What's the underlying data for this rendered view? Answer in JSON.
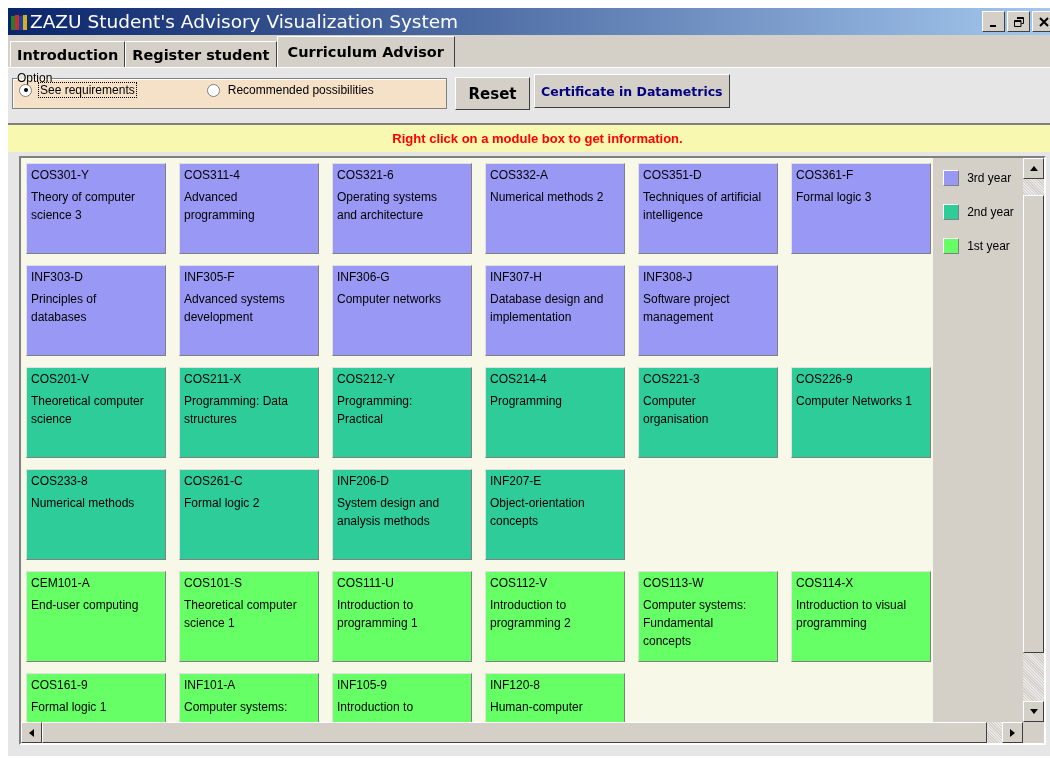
{
  "window": {
    "title": "ZAZU Student's Advisory Visualization System"
  },
  "tabs": [
    {
      "label": "Introduction",
      "selected": false
    },
    {
      "label": "Register student",
      "selected": false
    },
    {
      "label": "Curriculum  Advisor",
      "selected": true
    }
  ],
  "option": {
    "legend": "Option",
    "radios": [
      {
        "label": "See requirements",
        "selected": true
      },
      {
        "label": "Recommended possibilities",
        "selected": false
      }
    ]
  },
  "buttons": [
    {
      "label": "Reset",
      "kind": "plain"
    },
    {
      "label": "Certificate in Datametrics",
      "kind": "accent"
    }
  ],
  "hint": "Right click on a module box to get information.",
  "module_rows": [
    {
      "modules": [
        {
          "code": "COS301-Y",
          "title": "Theory of computer science 3",
          "color": "#9999f5"
        },
        {
          "code": "COS311-4",
          "title": "Advanced programming",
          "color": "#9999f5"
        },
        {
          "code": "COS321-6",
          "title": "Operating systems and architecture",
          "color": "#9999f5"
        },
        {
          "code": "COS332-A",
          "title": "Numerical methods 2",
          "color": "#9999f5"
        },
        {
          "code": "COS351-D",
          "title": "Techniques of artificial intelligence",
          "color": "#9999f5"
        },
        {
          "code": "COS361-F",
          "title": "Formal logic 3",
          "color": "#9999f5"
        }
      ]
    },
    {
      "modules": [
        {
          "code": "INF303-D",
          "title": "Principles of databases",
          "color": "#9999f5"
        },
        {
          "code": "INF305-F",
          "title": "Advanced systems development",
          "color": "#9999f5"
        },
        {
          "code": "INF306-G",
          "title": "Computer networks",
          "color": "#9999f5"
        },
        {
          "code": "INF307-H",
          "title": "Database design and implementation",
          "color": "#9999f5"
        },
        {
          "code": "INF308-J",
          "title": "Software project management",
          "color": "#9999f5"
        }
      ]
    },
    {
      "modules": [
        {
          "code": "COS201-V",
          "title": "Theoretical computer science",
          "color": "#2ecc99"
        },
        {
          "code": "COS211-X",
          "title": "Programming: Data structures",
          "color": "#2ecc99"
        },
        {
          "code": "COS212-Y",
          "title": "Programming: Practical",
          "color": "#2ecc99"
        },
        {
          "code": "COS214-4",
          "title": "Programming",
          "color": "#2ecc99"
        },
        {
          "code": "COS221-3",
          "title": "Computer organisation",
          "color": "#2ecc99"
        },
        {
          "code": "COS226-9",
          "title": "Computer Networks 1",
          "color": "#2ecc99"
        }
      ]
    },
    {
      "modules": [
        {
          "code": "COS233-8",
          "title": "Numerical methods",
          "color": "#2ecc99"
        },
        {
          "code": "COS261-C",
          "title": "Formal logic 2",
          "color": "#2ecc99"
        },
        {
          "code": "INF206-D",
          "title": "System design and analysis methods",
          "color": "#2ecc99"
        },
        {
          "code": "INF207-E",
          "title": "Object-orientation concepts",
          "color": "#2ecc99"
        }
      ]
    },
    {
      "modules": [
        {
          "code": "CEM101-A",
          "title": "End-user computing",
          "color": "#66ff66"
        },
        {
          "code": "COS101-S",
          "title": "Theoretical computer science 1",
          "color": "#66ff66"
        },
        {
          "code": "COS111-U",
          "title": "Introduction to programming 1",
          "color": "#66ff66"
        },
        {
          "code": "COS112-V",
          "title": "Introduction to programming 2",
          "color": "#66ff66"
        },
        {
          "code": "COS113-W",
          "title": "Computer systems: Fundamental concepts",
          "color": "#66ff66"
        },
        {
          "code": "COS114-X",
          "title": "Introduction to visual programming",
          "color": "#66ff66"
        }
      ]
    },
    {
      "modules": [
        {
          "code": "COS161-9",
          "title": "Formal logic 1",
          "color": "#66ff66"
        },
        {
          "code": "INF101-A",
          "title": "Computer systems:",
          "color": "#66ff66"
        },
        {
          "code": "INF105-9",
          "title": "Introduction to",
          "color": "#66ff66"
        },
        {
          "code": "INF120-8",
          "title": "Human-computer",
          "color": "#66ff66"
        }
      ]
    }
  ],
  "legend": [
    {
      "label": "3rd year",
      "color": "#9999f5"
    },
    {
      "label": "2nd year",
      "color": "#2ecc99"
    },
    {
      "label": "1st year",
      "color": "#66ff66"
    }
  ]
}
